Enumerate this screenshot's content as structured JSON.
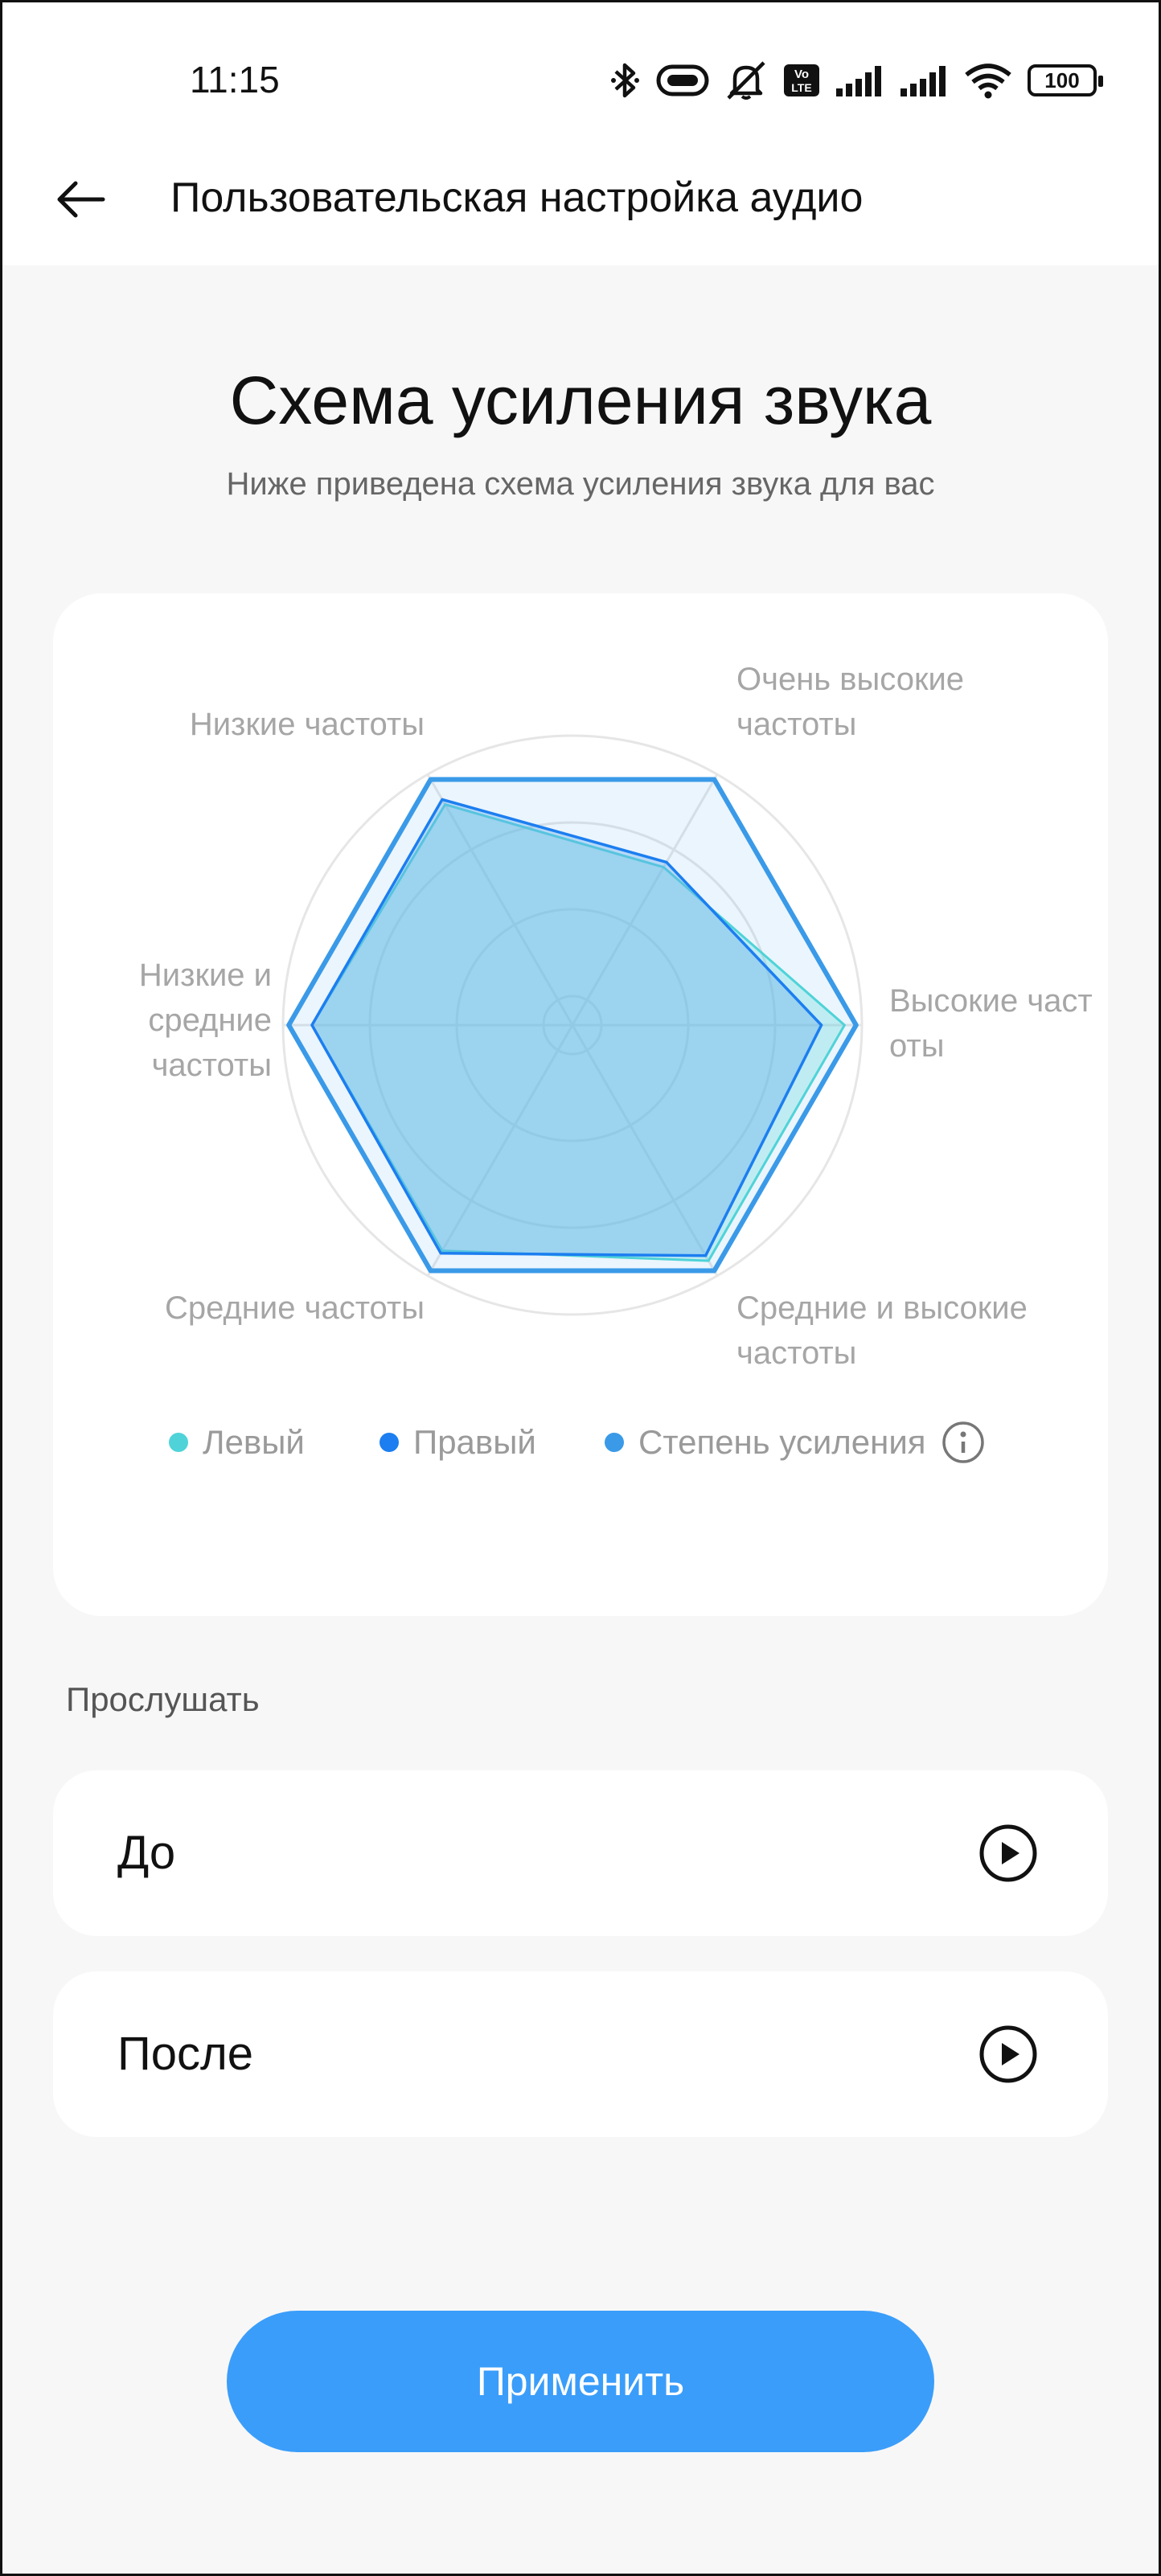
{
  "status_bar": {
    "time": "11:15",
    "lte_label": "Vo\nLTE",
    "battery": "100",
    "icons": [
      "bluetooth-icon",
      "link-icon",
      "mute-icon",
      "volte-icon",
      "signal-icon",
      "signal-icon",
      "wifi-icon",
      "battery-icon"
    ]
  },
  "header": {
    "title": "Пользовательская настройка аудио",
    "back_icon": "arrow-left-icon"
  },
  "section": {
    "title": "Схема усиления звука",
    "subtitle": "Ниже приведена схема усиления звука для вас"
  },
  "chart_data": {
    "type": "radar",
    "axes": [
      {
        "label_lines": [
          "Очень высокие",
          "частоты"
        ]
      },
      {
        "label_lines": [
          "Высокие част",
          "оты"
        ]
      },
      {
        "label_lines": [
          "Средние и высокие",
          "частоты"
        ]
      },
      {
        "label_lines": [
          "Средние частоты"
        ]
      },
      {
        "label_lines": [
          "Низкие и",
          "средние",
          "частоты"
        ]
      },
      {
        "label_lines": [
          "Низкие частоты"
        ]
      }
    ],
    "scale_max": 1.0,
    "rings": [
      0.1,
      0.4,
      0.7,
      1.0
    ],
    "series": [
      {
        "name": "Левый",
        "color": "#4fd3d8",
        "values": [
          0.63,
          0.94,
          0.94,
          0.9,
          0.9,
          0.88
        ]
      },
      {
        "name": "Правый",
        "color": "#1c7ef0",
        "values": [
          0.65,
          0.86,
          0.92,
          0.91,
          0.9,
          0.9
        ]
      },
      {
        "name": "Степень усиления",
        "color": "#3a9ae8",
        "values": [
          0.98,
          0.98,
          0.98,
          0.98,
          0.98,
          0.98
        ]
      }
    ],
    "legend_position": "bottom",
    "info_icon": "info-icon"
  },
  "listen": {
    "label": "Прослушать",
    "before_label": "До",
    "after_label": "После",
    "play_icon": "play-icon"
  },
  "apply_button": "Применить",
  "colors": {
    "accent": "#3a9dfa",
    "background": "#f7f7f7",
    "card": "#ffffff"
  }
}
